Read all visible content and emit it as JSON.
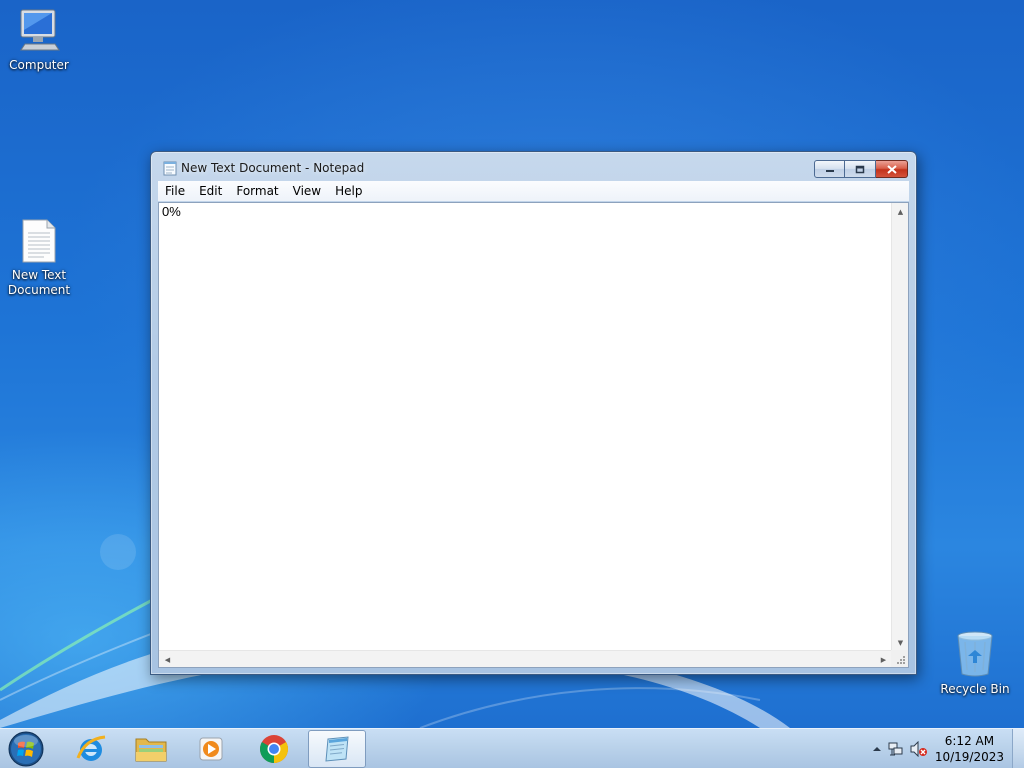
{
  "desktop": {
    "icons": [
      {
        "label": "Computer"
      },
      {
        "label": "New Text Document"
      },
      {
        "label": "Recycle Bin"
      }
    ]
  },
  "window": {
    "title": "New Text Document - Notepad",
    "icon": "notepad-icon",
    "controls": {
      "minimize": "minimize-icon",
      "maximize": "maximize-icon",
      "close": "close-icon"
    },
    "menu": [
      "File",
      "Edit",
      "Format",
      "View",
      "Help"
    ],
    "content": "0%"
  },
  "taskbar": {
    "pinned": [
      {
        "name": "Internet Explorer",
        "icon": "internet-explorer-icon"
      },
      {
        "name": "Windows Explorer",
        "icon": "folder-icon"
      },
      {
        "name": "Windows Media Player",
        "icon": "media-player-icon"
      },
      {
        "name": "Google Chrome",
        "icon": "chrome-icon"
      },
      {
        "name": "Notepad",
        "icon": "notepad-icon",
        "active": true
      }
    ],
    "tray": {
      "time": "6:12 AM",
      "date": "10/19/2023",
      "icons": [
        "show-hidden-icons",
        "network-icon",
        "volume-muted-icon"
      ]
    }
  },
  "colors": {
    "wallpaper": "#1e74d6",
    "taskbar": "#b9d1ea",
    "close_button": "#c3321b"
  }
}
